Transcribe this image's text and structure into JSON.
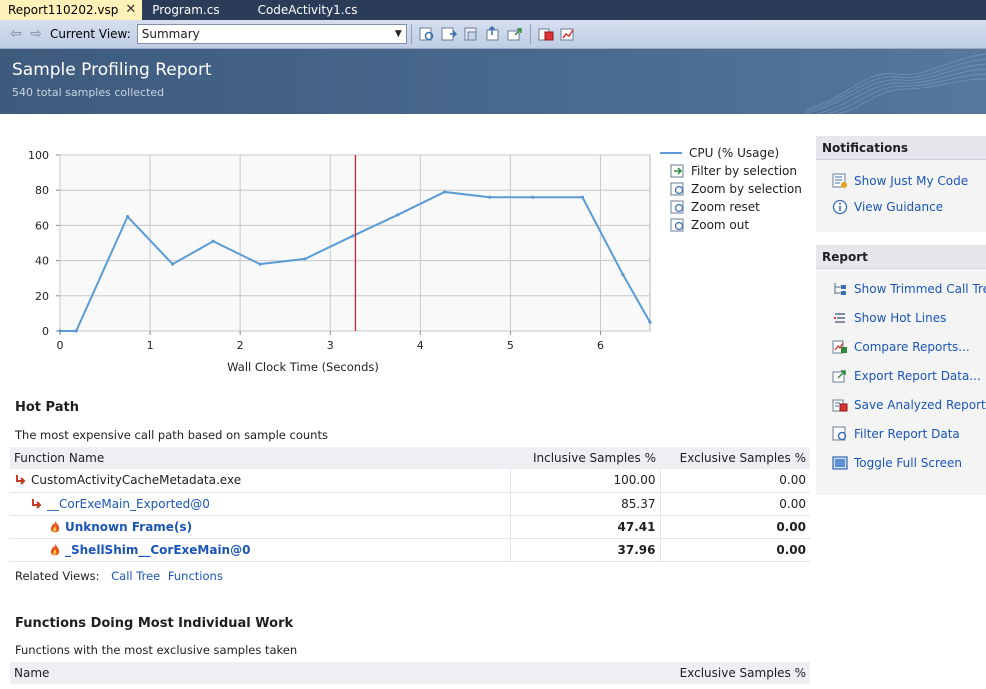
{
  "tabs": [
    {
      "label": "Report110202.vsp",
      "active": true
    },
    {
      "label": "Program.cs",
      "active": false
    },
    {
      "label": "CodeActivity1.cs",
      "active": false
    }
  ],
  "toolbar": {
    "current_view_label": "Current View:",
    "current_view_value": "Summary"
  },
  "header": {
    "title": "Sample Profiling Report",
    "subtitle": "540 total samples collected"
  },
  "chart_data": {
    "type": "line",
    "xlabel": "Wall Clock Time (Seconds)",
    "ylabel": "",
    "xlim": [
      0,
      6.55
    ],
    "ylim": [
      0,
      100
    ],
    "x_ticks": [
      "0",
      "1",
      "2",
      "3",
      "4",
      "5",
      "6"
    ],
    "y_ticks": [
      "0",
      "20",
      "40",
      "60",
      "80",
      "100"
    ],
    "grid": true,
    "legend_placement": "right",
    "series": [
      {
        "name": "CPU (% Usage)",
        "color": "#5b9bd5",
        "x": [
          0,
          0.18,
          0.75,
          1.25,
          1.7,
          2.22,
          2.72,
          3.25,
          3.75,
          4.27,
          4.77,
          5.25,
          5.8,
          6.25,
          6.55
        ],
        "y": [
          0,
          0,
          65,
          38,
          51,
          38,
          41,
          54,
          66,
          79,
          76,
          76,
          76,
          32,
          5
        ]
      }
    ],
    "marker_line_x": 3.28,
    "marker_line_color": "#c0272d",
    "legend_actions": [
      "Filter by selection",
      "Zoom by selection",
      "Zoom reset",
      "Zoom out"
    ]
  },
  "hot_path": {
    "title": "Hot Path",
    "description": "The most expensive call path based on sample counts",
    "columns": [
      "Function Name",
      "Inclusive Samples %",
      "Exclusive Samples %"
    ],
    "rows": [
      {
        "name": "CustomActivityCacheMetadata.exe",
        "inclusive": "100.00",
        "exclusive": "0.00",
        "icon": "call-arrow-icon",
        "indent": 0,
        "link": false,
        "bold": false
      },
      {
        "name": "__CorExeMain_Exported@0",
        "inclusive": "85.37",
        "exclusive": "0.00",
        "icon": "call-arrow-icon",
        "indent": 1,
        "link": true,
        "bold": false
      },
      {
        "name": "Unknown Frame(s)",
        "inclusive": "47.41",
        "exclusive": "0.00",
        "icon": "flame-icon",
        "indent": 2,
        "link": true,
        "bold": true
      },
      {
        "name": "_ShellShim__CorExeMain@0",
        "inclusive": "37.96",
        "exclusive": "0.00",
        "icon": "flame-icon",
        "indent": 2,
        "link": true,
        "bold": true
      }
    ],
    "related_label": "Related Views:",
    "related_links": [
      "Call Tree",
      "Functions"
    ]
  },
  "most_work": {
    "title": "Functions Doing Most Individual Work",
    "description": "Functions with the most exclusive samples taken",
    "columns": [
      "Name",
      "Exclusive Samples %"
    ]
  },
  "notifications": {
    "title": "Notifications",
    "items": [
      {
        "label": "Show Just My Code",
        "icon": "just-my-code-icon"
      },
      {
        "label": "View Guidance",
        "icon": "info-icon"
      }
    ]
  },
  "report_panel": {
    "title": "Report",
    "items": [
      {
        "label": "Show Trimmed Call Tree",
        "icon": "call-tree-icon"
      },
      {
        "label": "Show Hot Lines",
        "icon": "hot-lines-icon"
      },
      {
        "label": "Compare Reports...",
        "icon": "compare-icon"
      },
      {
        "label": "Export Report Data...",
        "icon": "export-icon"
      },
      {
        "label": "Save Analyzed Report...",
        "icon": "save-icon"
      },
      {
        "label": "Filter Report Data",
        "icon": "filter-icon"
      },
      {
        "label": "Toggle Full Screen",
        "icon": "full-screen-icon"
      }
    ]
  }
}
